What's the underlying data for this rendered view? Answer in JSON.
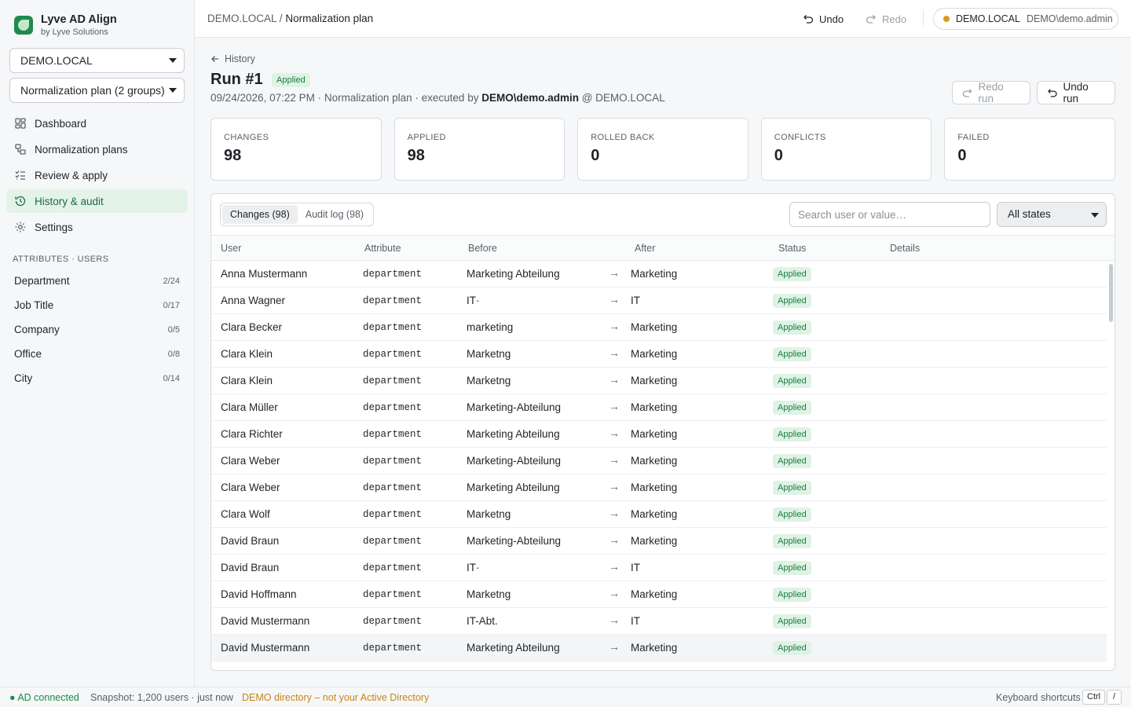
{
  "app": {
    "title": "Lyve AD Align",
    "subtitle": "by Lyve Solutions"
  },
  "sidebar": {
    "workspace_select": "DEMO.LOCAL",
    "plan_select": "Normalization plan (2 groups)",
    "nav": [
      {
        "label": "Dashboard",
        "icon": "dashboard-icon"
      },
      {
        "label": "Normalization plans",
        "icon": "plans-icon"
      },
      {
        "label": "Review & apply",
        "icon": "checklist-icon"
      },
      {
        "label": "History & audit",
        "icon": "history-icon",
        "active": true
      },
      {
        "label": "Settings",
        "icon": "gear-icon"
      }
    ],
    "section_title": "ATTRIBUTES · USERS",
    "attributes": [
      {
        "label": "Department",
        "count": "2/24"
      },
      {
        "label": "Job Title",
        "count": "0/17"
      },
      {
        "label": "Company",
        "count": "0/5"
      },
      {
        "label": "Office",
        "count": "0/8"
      },
      {
        "label": "City",
        "count": "0/14"
      }
    ]
  },
  "topbar": {
    "breadcrumb_root": "DEMO.LOCAL",
    "breadcrumb_sep": "/",
    "breadcrumb_current": "Normalization plan",
    "undo_label": "Undo",
    "redo_label": "Redo",
    "domain": "DEMO.LOCAL",
    "user": "DEMO\\demo.admin",
    "status_color": "#d89a1a"
  },
  "run": {
    "back_label": "History",
    "title": "Run #1",
    "status": "Applied",
    "meta_prefix": "09/24/2026, 07:22 PM · Normalization plan · executed by ",
    "meta_user": "DEMO\\demo.admin",
    "meta_suffix": " @ DEMO.LOCAL",
    "redo_run_label": "Redo run",
    "undo_run_label": "Undo run"
  },
  "stats": [
    {
      "label": "CHANGES",
      "value": "98"
    },
    {
      "label": "APPLIED",
      "value": "98"
    },
    {
      "label": "ROLLED BACK",
      "value": "0"
    },
    {
      "label": "CONFLICTS",
      "value": "0"
    },
    {
      "label": "FAILED",
      "value": "0"
    }
  ],
  "panel": {
    "tabs": [
      {
        "label": "Changes (98)",
        "active": true
      },
      {
        "label": "Audit log (98)"
      }
    ],
    "search_placeholder": "Search user or value…",
    "state_filter": "All states",
    "columns": [
      "User",
      "Attribute",
      "Before",
      "After",
      "Status",
      "Details"
    ],
    "arrow": "→",
    "rows": [
      {
        "user": "Anna Mustermann",
        "attribute": "department",
        "before": "Marketing Abteilung",
        "after": "Marketing",
        "status": "Applied"
      },
      {
        "user": "Anna Wagner",
        "attribute": "department",
        "before": "IT·",
        "after": "IT",
        "status": "Applied"
      },
      {
        "user": "Clara Becker",
        "attribute": "department",
        "before": "marketing",
        "after": "Marketing",
        "status": "Applied"
      },
      {
        "user": "Clara Klein",
        "attribute": "department",
        "before": "Marketng",
        "after": "Marketing",
        "status": "Applied"
      },
      {
        "user": "Clara Klein",
        "attribute": "department",
        "before": "Marketng",
        "after": "Marketing",
        "status": "Applied"
      },
      {
        "user": "Clara Müller",
        "attribute": "department",
        "before": "Marketing-Abteilung",
        "after": "Marketing",
        "status": "Applied"
      },
      {
        "user": "Clara Richter",
        "attribute": "department",
        "before": "Marketing Abteilung",
        "after": "Marketing",
        "status": "Applied"
      },
      {
        "user": "Clara Weber",
        "attribute": "department",
        "before": "Marketing-Abteilung",
        "after": "Marketing",
        "status": "Applied"
      },
      {
        "user": "Clara Weber",
        "attribute": "department",
        "before": "Marketing Abteilung",
        "after": "Marketing",
        "status": "Applied"
      },
      {
        "user": "Clara Wolf",
        "attribute": "department",
        "before": "Marketng",
        "after": "Marketing",
        "status": "Applied"
      },
      {
        "user": "David Braun",
        "attribute": "department",
        "before": "Marketing-Abteilung",
        "after": "Marketing",
        "status": "Applied"
      },
      {
        "user": "David Braun",
        "attribute": "department",
        "before": "IT·",
        "after": "IT",
        "status": "Applied"
      },
      {
        "user": "David Hoffmann",
        "attribute": "department",
        "before": "Marketng",
        "after": "Marketing",
        "status": "Applied"
      },
      {
        "user": "David Mustermann",
        "attribute": "department",
        "before": "IT-Abt.",
        "after": "IT",
        "status": "Applied"
      },
      {
        "user": "David Mustermann",
        "attribute": "department",
        "before": "Marketing Abteilung",
        "after": "Marketing",
        "status": "Applied"
      }
    ]
  },
  "statusbar": {
    "connection": "● AD connected",
    "snapshot": "Snapshot: 1,200 users · just now",
    "demo_notice": "DEMO directory – not your Active Directory",
    "shortcuts_label": "Keyboard shortcuts",
    "key_ctrl": "Ctrl",
    "key_slash": "/"
  },
  "colors": {
    "accent": "#1f8a4c",
    "applied_bg": "#dff3e5",
    "applied_text": "#1c7a44",
    "warning": "#c8841a"
  }
}
